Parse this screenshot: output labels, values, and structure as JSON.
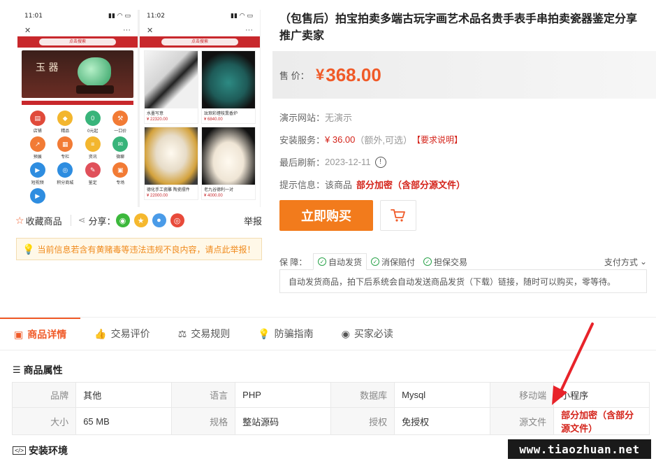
{
  "gallery": {
    "phone1": {
      "time": "11:01",
      "search": "点击搜索",
      "banner_text": "玉 器",
      "icons": [
        {
          "label": "店铺",
          "icon": "shop-icon",
          "color": "red"
        },
        {
          "label": "精品",
          "icon": "diamond-icon",
          "color": "yel"
        },
        {
          "label": "0元起",
          "icon": "zero-icon",
          "color": "grn"
        },
        {
          "label": "一口价",
          "icon": "hammer-icon",
          "color": "ora"
        },
        {
          "label": "预展",
          "icon": "chart-icon",
          "color": "ora"
        },
        {
          "label": "专栏",
          "icon": "column-icon",
          "color": "ora"
        },
        {
          "label": "资讯",
          "icon": "news-icon",
          "color": "yel"
        },
        {
          "label": "微聊",
          "icon": "chat-icon",
          "color": "grn"
        },
        {
          "label": "短视频",
          "icon": "video-icon",
          "color": "blu"
        },
        {
          "label": "积分商城",
          "icon": "points-icon",
          "color": "blu"
        },
        {
          "label": "鉴定",
          "icon": "appraise-icon",
          "color": "pink"
        },
        {
          "label": "专场",
          "icon": "venue-icon",
          "color": "ora"
        },
        {
          "label": "",
          "icon": "video-icon",
          "color": "blu"
        }
      ]
    },
    "phone2": {
      "time": "11:02",
      "search": "点击搜索",
      "cards": [
        {
          "caption": "水墨写意",
          "price": "¥ 22320.00",
          "img": "ink"
        },
        {
          "caption": "珐琅彩缠枝熏香炉",
          "price": "¥ 6840.00",
          "img": "bronze"
        },
        {
          "caption": "德化手工瓷雕 陶瓷摆件",
          "price": "¥ 22000.00",
          "img": "buddha"
        },
        {
          "caption": "老九谷德利一对",
          "price": "¥ 4000.00",
          "img": "vase"
        }
      ]
    }
  },
  "share": {
    "favorite": "收藏商品",
    "share_label": "分享：",
    "report": "举报"
  },
  "warning": "当前信息若含有黄赌毒等违法违规不良内容，请点此举报！",
  "product": {
    "title": "（包售后）拍宝拍卖多端古玩字画艺术品名贵手表手串拍卖瓷器鉴定分享推广卖家",
    "price_label": "售 价：",
    "price_currency": "¥",
    "price": "368.00",
    "demo_label": "演示网站：",
    "demo_value": "无演示",
    "service_label": "安装服务：",
    "service_price": "¥ 36.00",
    "service_note": "（额外,可选）",
    "service_link": "【要求说明】",
    "refresh_label": "最后刷新：",
    "refresh_value": "2023-12-11",
    "tip_label": "提示信息：",
    "tip_prefix": "该商品",
    "tip_value": "部分加密（含部分源文件）",
    "buy_label": "立即购买"
  },
  "guarantee": {
    "label": "保 障：",
    "tabs": [
      "自动发货",
      "消保赔付",
      "担保交易"
    ],
    "pay": "支付方式",
    "desc": "自动发货商品，拍下后系统会自动发送商品发货（下载）链接，随时可以购买，零等待。"
  },
  "tabs": [
    {
      "label": "商品详情",
      "icon": "detail-icon",
      "active": true
    },
    {
      "label": "交易评价",
      "icon": "thumb-icon",
      "active": false
    },
    {
      "label": "交易规则",
      "icon": "scale-icon",
      "active": false
    },
    {
      "label": "防骗指南",
      "icon": "bulb-icon",
      "active": false
    },
    {
      "label": "买家必读",
      "icon": "target-icon",
      "active": false
    }
  ],
  "attributes": {
    "title": "商品属性",
    "rows": [
      [
        [
          "品牌",
          "其他"
        ],
        [
          "语言",
          "PHP"
        ],
        [
          "数据库",
          "Mysql"
        ],
        [
          "移动端",
          "小程序"
        ]
      ],
      [
        [
          "大小",
          "65 MB"
        ],
        [
          "规格",
          "整站源码"
        ],
        [
          "授权",
          "免授权"
        ],
        [
          "源文件",
          "部分加密（含部分源文件）"
        ]
      ]
    ]
  },
  "install_env": {
    "title": "安装环境"
  },
  "watermark": "www.tiaozhuan.net",
  "colors": {
    "accent": "#f05a28",
    "buy": "#f27b1c",
    "red": "#d4231a",
    "brand_red": "#c8282c",
    "check_green": "#2aa34a"
  }
}
